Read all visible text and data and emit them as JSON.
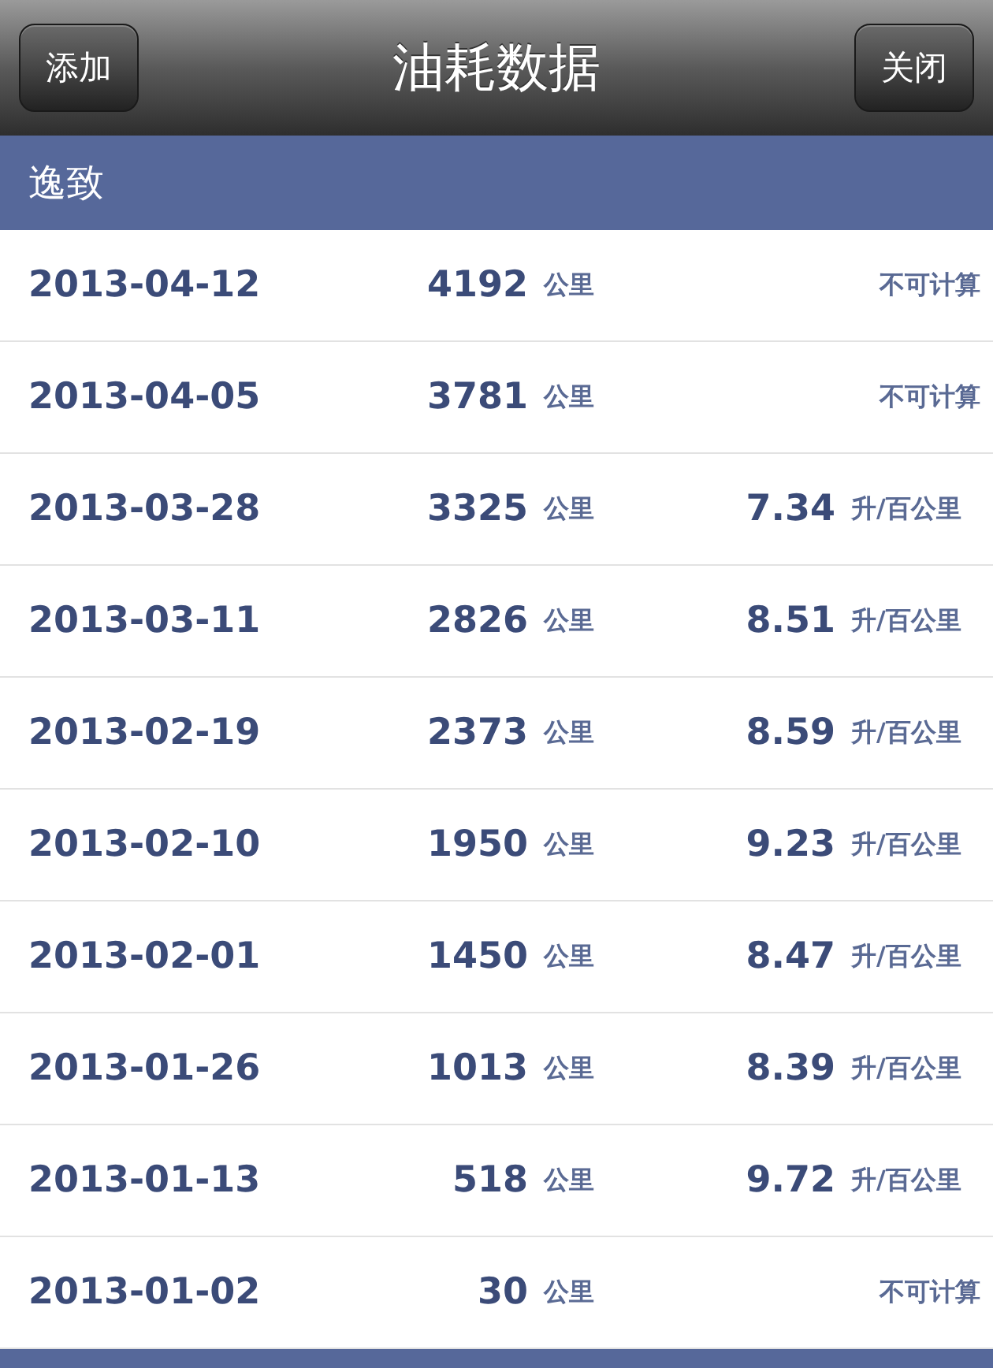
{
  "nav_bar": {
    "left_button": "添加",
    "title": "油耗数据",
    "right_button": "关闭"
  },
  "section": {
    "title": "逸致"
  },
  "records": [
    {
      "date": "2013-04-12",
      "distance": "4192",
      "distance_unit": "公里",
      "kind": "na",
      "consumption": "不可计算"
    },
    {
      "date": "2013-04-05",
      "distance": "3781",
      "distance_unit": "公里",
      "kind": "na",
      "consumption": "不可计算"
    },
    {
      "date": "2013-03-28",
      "distance": "3325",
      "distance_unit": "公里",
      "kind": "value",
      "consumption": "7.34",
      "consumption_unit": "升/百公里"
    },
    {
      "date": "2013-03-11",
      "distance": "2826",
      "distance_unit": "公里",
      "kind": "value",
      "consumption": "8.51",
      "consumption_unit": "升/百公里"
    },
    {
      "date": "2013-02-19",
      "distance": "2373",
      "distance_unit": "公里",
      "kind": "value",
      "consumption": "8.59",
      "consumption_unit": "升/百公里"
    },
    {
      "date": "2013-02-10",
      "distance": "1950",
      "distance_unit": "公里",
      "kind": "value",
      "consumption": "9.23",
      "consumption_unit": "升/百公里"
    },
    {
      "date": "2013-02-01",
      "distance": "1450",
      "distance_unit": "公里",
      "kind": "value",
      "consumption": "8.47",
      "consumption_unit": "升/百公里"
    },
    {
      "date": "2013-01-26",
      "distance": "1013",
      "distance_unit": "公里",
      "kind": "value",
      "consumption": "8.39",
      "consumption_unit": "升/百公里"
    },
    {
      "date": "2013-01-13",
      "distance": "518",
      "distance_unit": "公里",
      "kind": "value",
      "consumption": "9.72",
      "consumption_unit": "升/百公里"
    },
    {
      "date": "2013-01-02",
      "distance": "30",
      "distance_unit": "公里",
      "kind": "na",
      "consumption": "不可计算"
    }
  ]
}
